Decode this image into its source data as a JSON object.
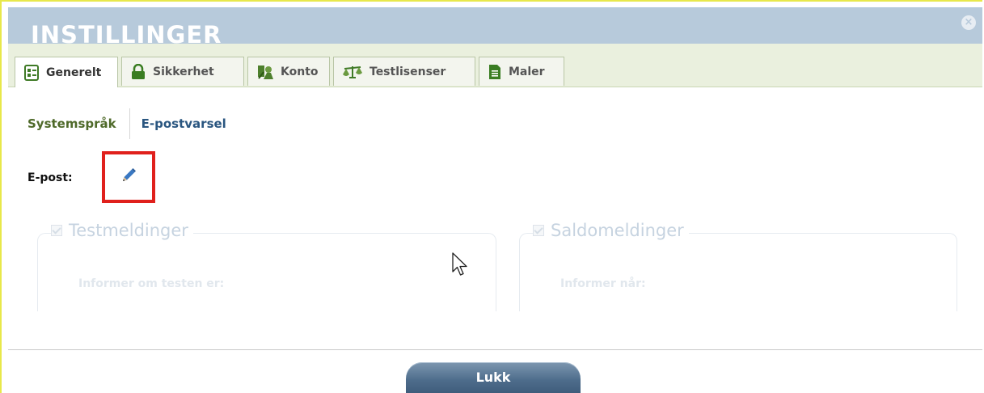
{
  "dialog": {
    "title": "INSTILLINGER",
    "close_glyph": "×"
  },
  "tabs": [
    {
      "label": "Generelt",
      "icon": "settings-form-icon",
      "active": true
    },
    {
      "label": "Sikkerhet",
      "icon": "lock-icon",
      "active": false
    },
    {
      "label": "Konto",
      "icon": "account-icon",
      "active": false
    },
    {
      "label": "Testlisenser",
      "icon": "scales-icon",
      "active": false
    },
    {
      "label": "Maler",
      "icon": "document-icon",
      "active": false
    }
  ],
  "subnav": {
    "systemsprak": "Systemspråk",
    "epostvarsel": "E-postvarsel"
  },
  "email": {
    "label": "E-post:",
    "edit_icon": "pencil-icon",
    "highlight_color": "#e0201c"
  },
  "sections": {
    "test": {
      "title": "Testmeldinger",
      "subtitle": "Informer om testen er:"
    },
    "saldo": {
      "title": "Saldomeldinger",
      "subtitle": "Informer når:"
    }
  },
  "footer": {
    "close_label": "Lukk"
  },
  "colors": {
    "titlebar": "#b7cadb",
    "tabbar": "#eaf0de",
    "button": "#4e6d8c",
    "link_green": "#4f6a2a",
    "link_blue": "#2a5680"
  }
}
